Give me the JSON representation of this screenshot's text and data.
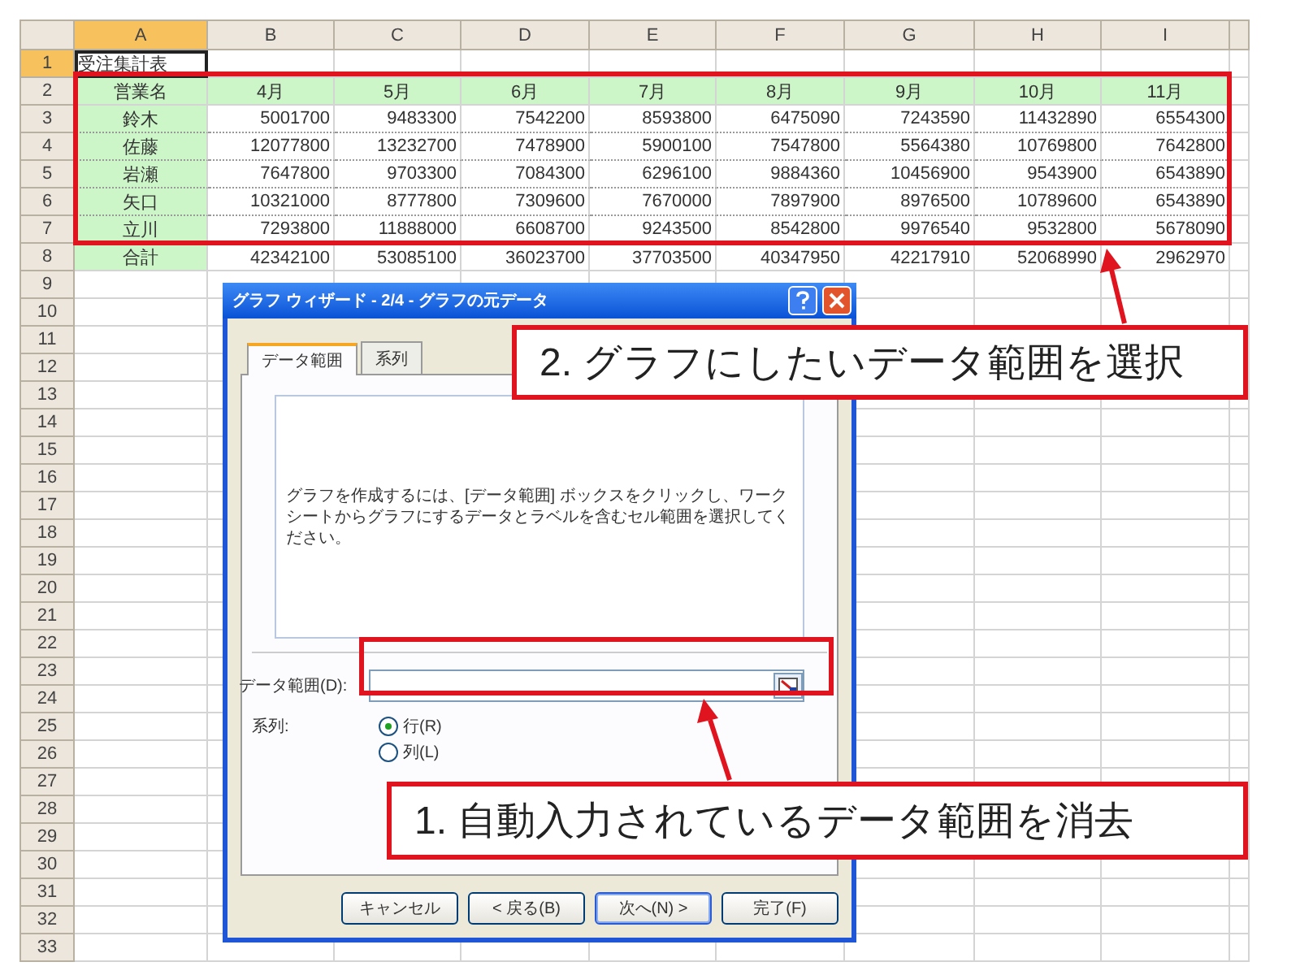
{
  "sheet": {
    "columns": [
      {
        "label": "A",
        "selected": true
      },
      {
        "label": "B",
        "selected": false
      },
      {
        "label": "C",
        "selected": false
      },
      {
        "label": "D",
        "selected": false
      },
      {
        "label": "E",
        "selected": false
      },
      {
        "label": "F",
        "selected": false
      },
      {
        "label": "G",
        "selected": false
      },
      {
        "label": "H",
        "selected": false
      },
      {
        "label": "I",
        "selected": false
      }
    ],
    "rows": [
      {
        "number": "1",
        "selected": true,
        "kind": "title",
        "cells": [
          "受注集計表"
        ]
      },
      {
        "number": "2",
        "selected": false,
        "kind": "header",
        "cells": [
          "営業名",
          "4月",
          "5月",
          "6月",
          "7月",
          "8月",
          "9月",
          "10月",
          "11月"
        ]
      },
      {
        "number": "3",
        "selected": false,
        "kind": "data",
        "cells": [
          "鈴木",
          "5001700",
          "9483300",
          "7542200",
          "8593800",
          "6475090",
          "7243590",
          "11432890",
          "6554300"
        ]
      },
      {
        "number": "4",
        "selected": false,
        "kind": "data",
        "cells": [
          "佐藤",
          "12077800",
          "13232700",
          "7478900",
          "5900100",
          "7547800",
          "5564380",
          "10769800",
          "7642800"
        ]
      },
      {
        "number": "5",
        "selected": false,
        "kind": "data",
        "cells": [
          "岩瀬",
          "7647800",
          "9703300",
          "7084300",
          "6296100",
          "9884360",
          "10456900",
          "9543900",
          "6543890"
        ]
      },
      {
        "number": "6",
        "selected": false,
        "kind": "data",
        "cells": [
          "矢口",
          "10321000",
          "8777800",
          "7309600",
          "7670000",
          "7897900",
          "8976500",
          "10789600",
          "6543890"
        ]
      },
      {
        "number": "7",
        "selected": false,
        "kind": "data",
        "cells": [
          "立川",
          "7293800",
          "11888000",
          "6608700",
          "9243500",
          "8542800",
          "9976540",
          "9532800",
          "5678090"
        ]
      },
      {
        "number": "8",
        "selected": false,
        "kind": "total",
        "cells": [
          "合計",
          "42342100",
          "53085100",
          "36023700",
          "37703500",
          "40347950",
          "42217910",
          "52068990",
          "2962970"
        ]
      },
      {
        "number": "9",
        "selected": false,
        "kind": "empty"
      },
      {
        "number": "10",
        "selected": false,
        "kind": "empty"
      },
      {
        "number": "11",
        "selected": false,
        "kind": "empty"
      },
      {
        "number": "12",
        "selected": false,
        "kind": "empty"
      },
      {
        "number": "13",
        "selected": false,
        "kind": "empty"
      },
      {
        "number": "14",
        "selected": false,
        "kind": "empty"
      },
      {
        "number": "15",
        "selected": false,
        "kind": "empty"
      },
      {
        "number": "16",
        "selected": false,
        "kind": "empty"
      },
      {
        "number": "17",
        "selected": false,
        "kind": "empty"
      },
      {
        "number": "18",
        "selected": false,
        "kind": "empty"
      },
      {
        "number": "19",
        "selected": false,
        "kind": "empty"
      },
      {
        "number": "20",
        "selected": false,
        "kind": "empty"
      },
      {
        "number": "21",
        "selected": false,
        "kind": "empty"
      },
      {
        "number": "22",
        "selected": false,
        "kind": "empty"
      },
      {
        "number": "23",
        "selected": false,
        "kind": "empty"
      },
      {
        "number": "24",
        "selected": false,
        "kind": "empty"
      },
      {
        "number": "25",
        "selected": false,
        "kind": "empty"
      },
      {
        "number": "26",
        "selected": false,
        "kind": "empty"
      },
      {
        "number": "27",
        "selected": false,
        "kind": "empty"
      },
      {
        "number": "28",
        "selected": false,
        "kind": "empty"
      },
      {
        "number": "29",
        "selected": false,
        "kind": "empty"
      },
      {
        "number": "30",
        "selected": false,
        "kind": "empty"
      },
      {
        "number": "31",
        "selected": false,
        "kind": "empty"
      },
      {
        "number": "32",
        "selected": false,
        "kind": "empty"
      },
      {
        "number": "33",
        "selected": false,
        "kind": "empty"
      }
    ]
  },
  "dialog": {
    "title": "グラフ ウィザード - 2/4 - グラフの元データ",
    "tabs": [
      {
        "label": "データ範囲",
        "selected": true
      },
      {
        "label": "系列",
        "selected": false
      }
    ],
    "instruction": "グラフを作成するには、[データ範囲] ボックスをクリックし、ワークシートからグラフにするデータとラベルを含むセル範囲を選択してください。",
    "range_field": {
      "label": "データ範囲(D):"
    },
    "series": {
      "label": "系列:",
      "options": [
        {
          "label": "行(R)",
          "selected": true
        },
        {
          "label": "列(L)",
          "selected": false
        }
      ]
    },
    "buttons": [
      {
        "label": "キャンセル",
        "default": false
      },
      {
        "label": "< 戻る(B)",
        "default": false
      },
      {
        "label": "次へ(N) >",
        "default": true
      },
      {
        "label": "完了(F)",
        "default": false
      }
    ]
  },
  "callouts": [
    {
      "text": "2. グラフにしたいデータ範囲を選択"
    },
    {
      "text": "1. 自動入力されているデータ範囲を消去"
    }
  ]
}
